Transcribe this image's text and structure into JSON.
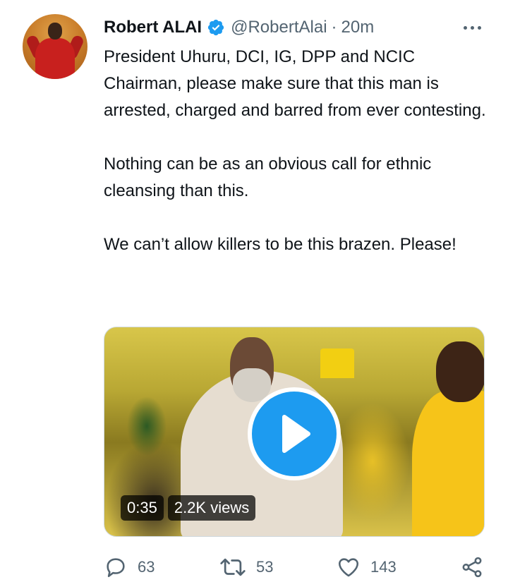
{
  "tweet": {
    "author_name": "Robert ALAI",
    "handle": "@RobertAlai",
    "separator": "·",
    "time": "20m",
    "paragraphs": [
      "President Uhuru, DCI, IG, DPP and NCIC Chairman, please make sure that this man is arrested, charged and barred from ever contesting.",
      "Nothing can be as an obvious call for ethnic cleansing than this.",
      "We can’t allow killers to be this brazen. Please!"
    ]
  },
  "video": {
    "duration": "0:35",
    "views": "2.2K views"
  },
  "actions": {
    "replies": "63",
    "retweets": "53",
    "likes": "143"
  },
  "icons": {
    "verified": "verified-badge-icon",
    "more": "more-options-icon",
    "play": "play-icon",
    "reply": "reply-icon",
    "retweet": "retweet-icon",
    "like": "heart-icon",
    "share": "share-icon"
  },
  "colors": {
    "accent": "#1d9bf0",
    "text": "#0f1419",
    "secondary": "#536471"
  }
}
